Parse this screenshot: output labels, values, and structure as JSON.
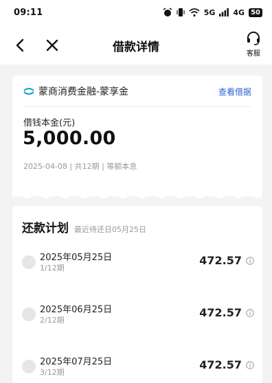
{
  "status": {
    "time": "09:11",
    "network": "5G",
    "network2": "4G",
    "battery": "50"
  },
  "nav": {
    "title": "借款详情",
    "service_label": "客服"
  },
  "loan": {
    "product_name": "蒙商消费金融-蒙享金",
    "view_loan_label": "查看借据",
    "principal_label": "借钱本金(元)",
    "principal_amount": "5,000.00",
    "meta": "2025-04-08 | 共12期 | 等额本息"
  },
  "plan": {
    "title": "还款计划",
    "subtitle": "最近待还日05月25日",
    "rows": [
      {
        "date": "2025年05月25日",
        "period": "1/12期",
        "amount": "472.57"
      },
      {
        "date": "2025年06月25日",
        "period": "2/12期",
        "amount": "472.57"
      },
      {
        "date": "2025年07月25日",
        "period": "3/12期",
        "amount": "472.57"
      }
    ]
  },
  "colors": {
    "accent": "#2b63d9",
    "logo": "#1aa3c8"
  },
  "icons": [
    "alarm-icon",
    "vibrate-icon",
    "wifi-icon",
    "signal-icon",
    "battery-icon",
    "back-arrow-icon",
    "close-icon",
    "headset-icon",
    "brand-logo-icon",
    "info-icon"
  ]
}
